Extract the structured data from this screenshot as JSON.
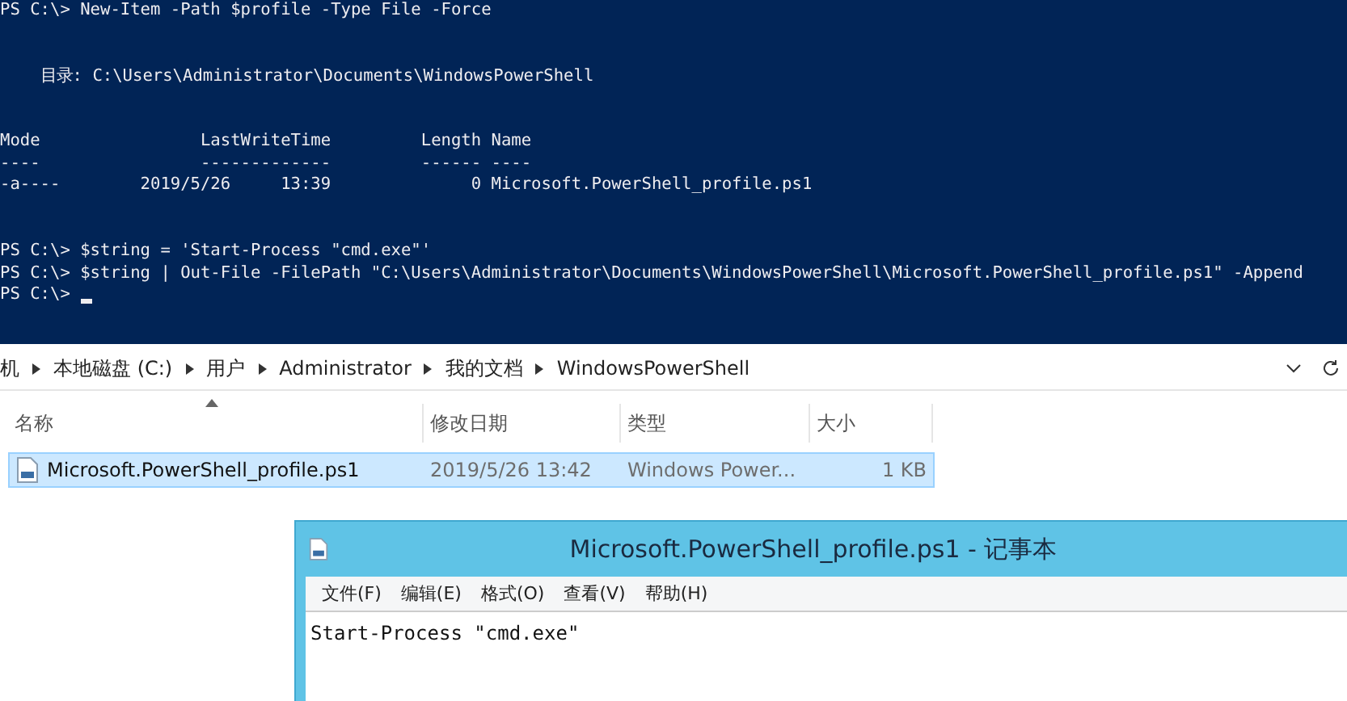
{
  "terminal": {
    "blocks": [
      [
        "PS C:\\> New-Item -Path $profile -Type File -Force"
      ],
      [
        "    目录: C:\\Users\\Administrator\\Documents\\WindowsPowerShell"
      ],
      [
        "Mode                LastWriteTime         Length Name",
        "----                -------------         ------ ----",
        "-a----        2019/5/26     13:39              0 Microsoft.PowerShell_profile.ps1"
      ],
      [
        "PS C:\\> $string = 'Start-Process \"cmd.exe\"'",
        "PS C:\\> $string | Out-File -FilePath \"C:\\Users\\Administrator\\Documents\\WindowsPowerShell\\Microsoft.PowerShell_profile.ps1\" -Append",
        "PS C:\\> "
      ]
    ]
  },
  "explorer": {
    "breadcrumb": [
      "机",
      "本地磁盘 (C:)",
      "用户",
      "Administrator",
      "我的文档",
      "WindowsPowerShell"
    ],
    "columns": [
      {
        "label": "名称",
        "sorted": true
      },
      {
        "label": "修改日期",
        "sorted": false
      },
      {
        "label": "类型",
        "sorted": false
      },
      {
        "label": "大小",
        "sorted": false
      }
    ],
    "files": [
      {
        "name": "Microsoft.PowerShell_profile.ps1",
        "modified": "2019/5/26 13:42",
        "type": "Windows Power...",
        "size": "1 KB",
        "selected": true
      }
    ]
  },
  "notepad": {
    "title": "Microsoft.PowerShell_profile.ps1 - 记事本",
    "menu": [
      "文件(F)",
      "编辑(E)",
      "格式(O)",
      "查看(V)",
      "帮助(H)"
    ],
    "content": "Start-Process \"cmd.exe\""
  }
}
